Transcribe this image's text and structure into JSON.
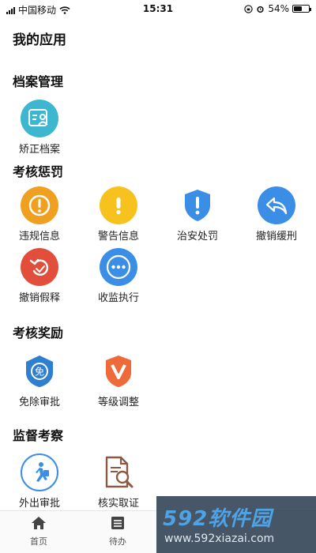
{
  "status_bar": {
    "carrier": "中国移动",
    "time": "15:31",
    "battery_percent": "54%",
    "battery_level": 0.54
  },
  "page": {
    "title": "我的应用"
  },
  "sections": [
    {
      "title": "档案管理",
      "items": [
        {
          "label": "矫正档案",
          "icon": "archive-icon",
          "color": "#3db6d0"
        }
      ]
    },
    {
      "title": "考核惩罚",
      "items": [
        {
          "label": "违规信息",
          "icon": "exclamation-circle-icon",
          "color": "#f0a020"
        },
        {
          "label": "警告信息",
          "icon": "exclamation-icon",
          "color": "#f7c21e"
        },
        {
          "label": "治安处罚",
          "icon": "shield-alert-icon",
          "color": "#3a8ee6"
        },
        {
          "label": "撤销缓刑",
          "icon": "undo-arrow-icon",
          "color": "#3a8ee6"
        },
        {
          "label": "撤销假释",
          "icon": "undo-arrow-icon",
          "color": "#e14f3c"
        },
        {
          "label": "收监执行",
          "icon": "more-icon",
          "color": "#3a8ee6"
        }
      ]
    },
    {
      "title": "考核奖励",
      "items": [
        {
          "label": "免除审批",
          "icon": "exempt-shield-icon",
          "color": "#2f7fd1"
        },
        {
          "label": "等级调整",
          "icon": "level-shield-icon",
          "color": "#ee6a3a"
        }
      ]
    },
    {
      "title": "监督考察",
      "items": [
        {
          "label": "外出审批",
          "icon": "walking-person-icon",
          "color": "#3a8ee6"
        },
        {
          "label": "核实取证",
          "icon": "document-search-icon",
          "color": "#8a5a44"
        }
      ]
    }
  ],
  "tab_bar": {
    "tabs": [
      {
        "label": "首页",
        "icon": "home-icon"
      },
      {
        "label": "待办",
        "icon": "list-icon"
      }
    ]
  },
  "watermark": {
    "logo": "592软件园",
    "url": "www.592xiazai.com"
  }
}
